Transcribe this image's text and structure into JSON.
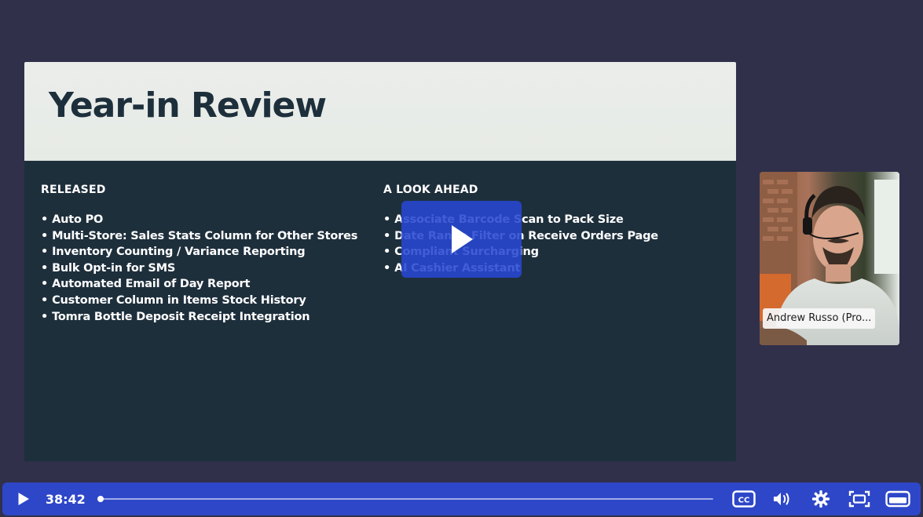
{
  "slide": {
    "title": "Year-in Review",
    "released": {
      "heading": "RELEASED",
      "items": [
        "Auto PO",
        "Multi-Store: Sales Stats Column for Other Stores",
        "Inventory Counting / Variance Reporting",
        "Bulk Opt-in for SMS",
        "Automated Email of Day Report",
        "Customer Column in Items Stock History",
        "Tomra Bottle Deposit Receipt Integration"
      ]
    },
    "ahead": {
      "heading": "A LOOK AHEAD",
      "items": [
        "Associate Barcode Scan to Pack Size",
        "Date Range Filter on Receive Orders Page",
        "Compliant Surcharging",
        "AI Cashier Assistant"
      ]
    }
  },
  "webcam": {
    "participant_name": "Andrew Russo (Pro..."
  },
  "controls": {
    "current_time": "38:42",
    "progress_fraction": 0.0,
    "cc_label": "CC"
  },
  "colors": {
    "control_bar": "#2e47c9",
    "slide_body": "#1e2f3c",
    "slide_header": "#e9ece8",
    "background": "#30304a"
  },
  "icons": {
    "center_play": "play-icon",
    "bar_play": "play-icon",
    "captions": "closed-captions-icon",
    "volume": "volume-icon",
    "settings": "gear-icon",
    "theater": "theater-mode-icon",
    "fullscreen": "fullscreen-icon"
  }
}
